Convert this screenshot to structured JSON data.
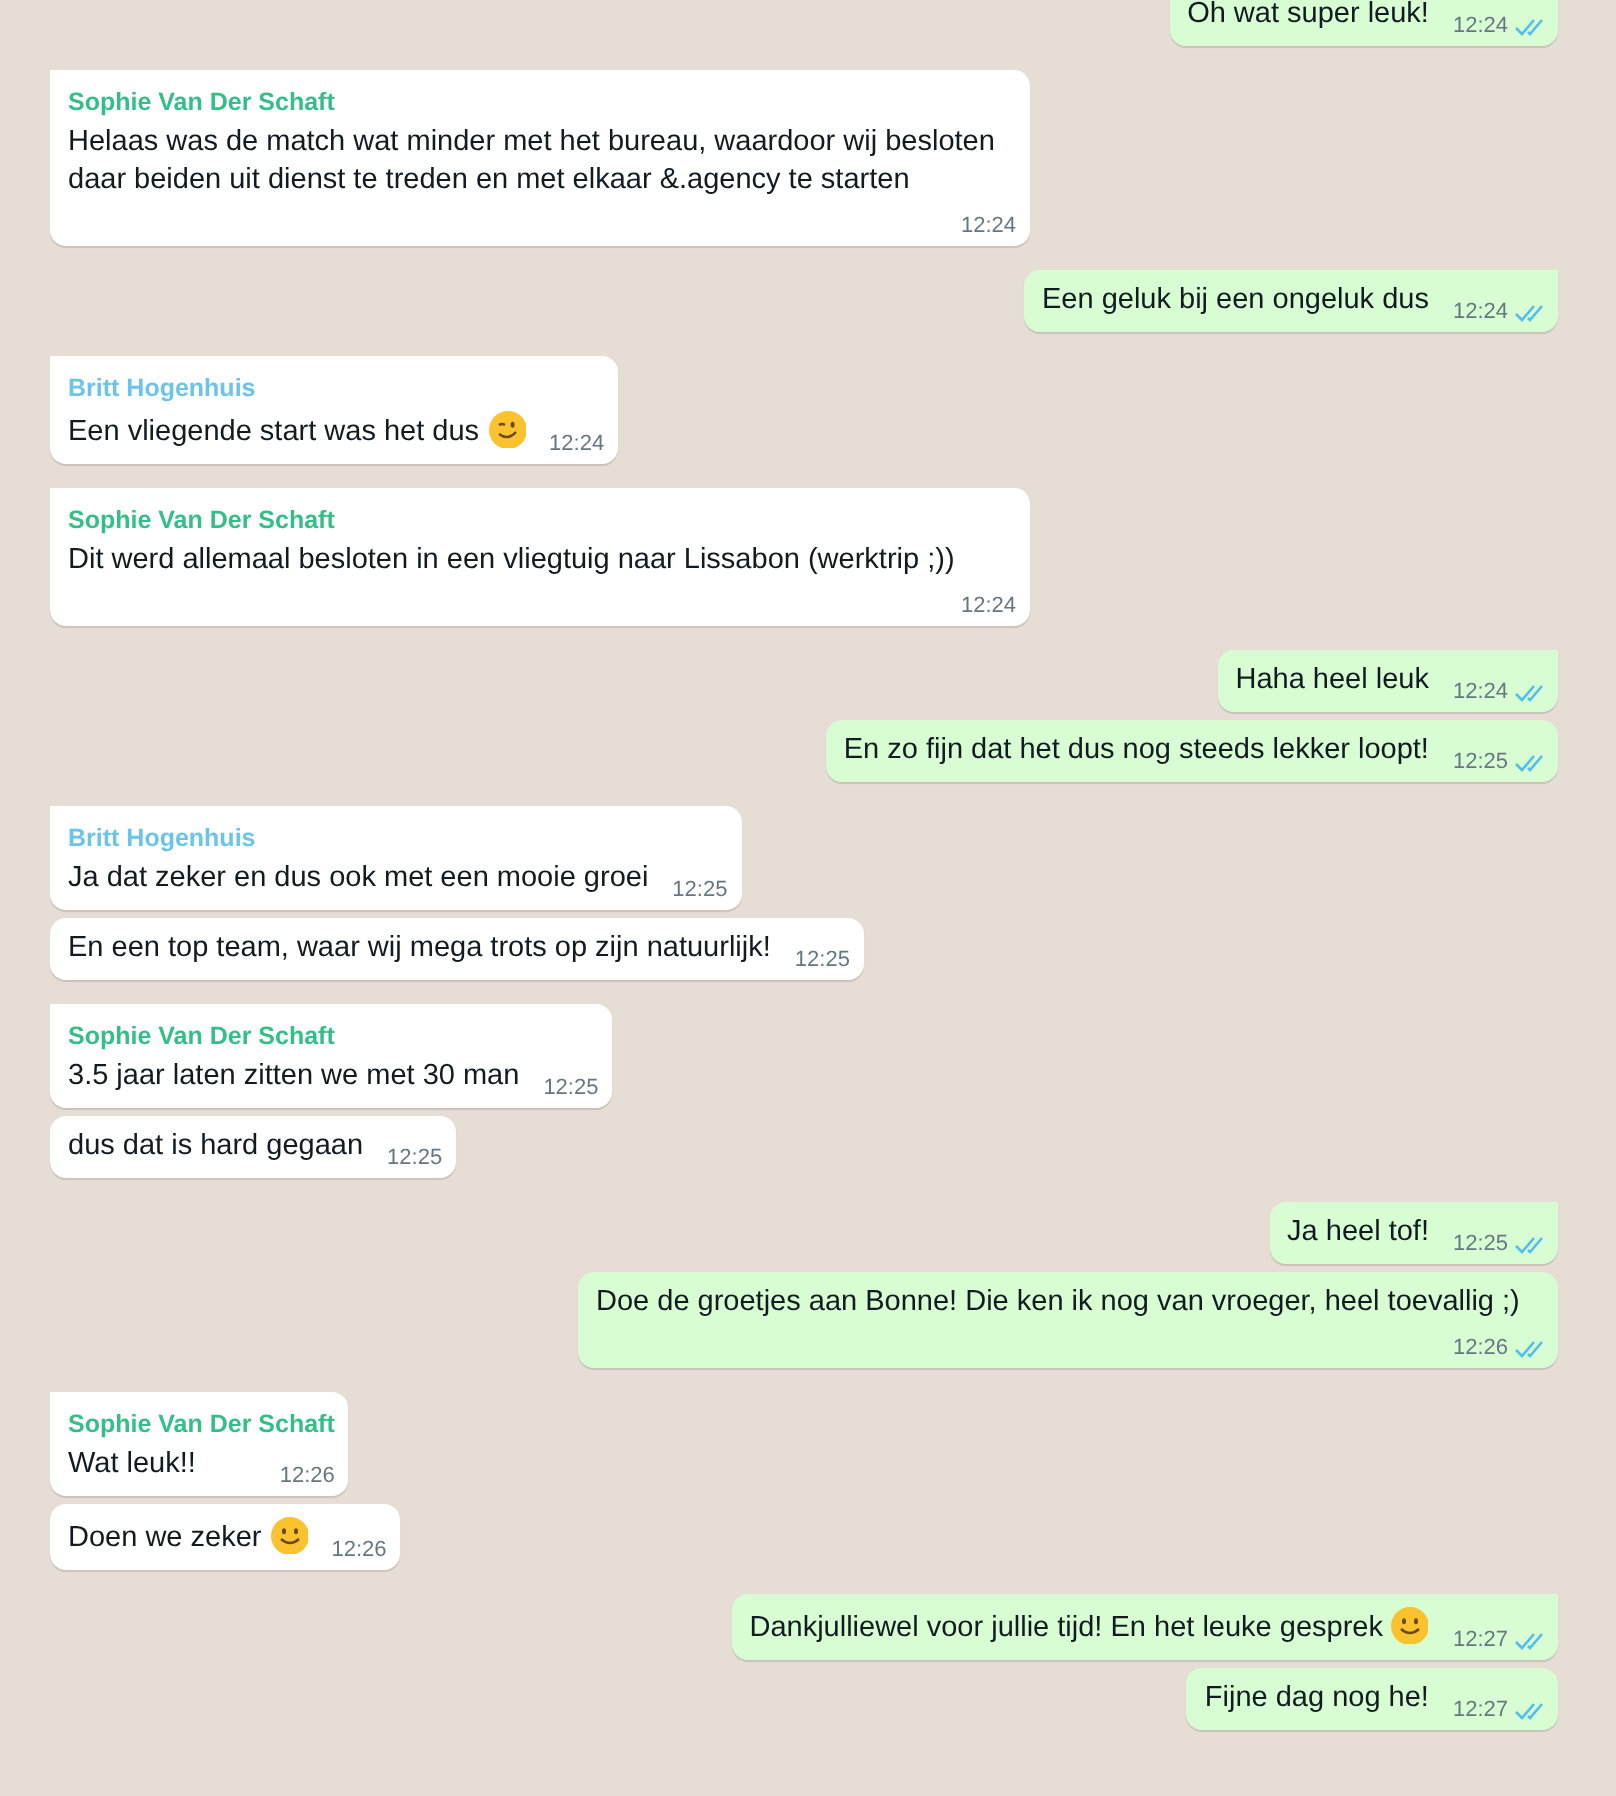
{
  "messages": [
    {
      "kind": "sent",
      "tail": false,
      "text": "Oh wat super leuk!",
      "time": "12:24",
      "read": true
    },
    {
      "kind": "received",
      "tail": true,
      "sender": {
        "name": "Sophie Van Der Schaft",
        "color": "#35bf88"
      },
      "text": "Helaas was de match wat minder met het bureau, waardoor wij besloten daar beiden uit dienst te treden en met elkaar &.agency te starten",
      "time": "12:24"
    },
    {
      "kind": "sent",
      "tail": true,
      "text": "Een geluk bij een ongeluk dus",
      "time": "12:24",
      "read": true
    },
    {
      "kind": "received",
      "tail": true,
      "sender": {
        "name": "Britt Hogenhuis",
        "color": "#6bc4ea"
      },
      "text": "Een vliegende start was het dus",
      "emoji": {
        "kind": "wink"
      },
      "time": "12:24"
    },
    {
      "kind": "received",
      "tail": true,
      "sender": {
        "name": "Sophie Van Der Schaft",
        "color": "#35bf88"
      },
      "text": "Dit werd allemaal besloten in een vliegtuig naar Lissabon (werktrip ;))",
      "time": "12:24"
    },
    {
      "kind": "sent",
      "tail": true,
      "text": "Haha heel leuk",
      "time": "12:24",
      "read": true
    },
    {
      "kind": "sent",
      "tail": false,
      "text": "En zo fijn dat het dus nog steeds lekker loopt!",
      "time": "12:25",
      "read": true
    },
    {
      "kind": "received",
      "tail": true,
      "sender": {
        "name": "Britt Hogenhuis",
        "color": "#6bc4ea"
      },
      "text": "Ja dat zeker en dus ook met een mooie groei",
      "time": "12:25"
    },
    {
      "kind": "received",
      "tail": false,
      "text": "En een top team, waar wij mega trots op zijn natuurlijk!",
      "time": "12:25"
    },
    {
      "kind": "received",
      "tail": true,
      "sender": {
        "name": "Sophie Van Der Schaft",
        "color": "#35bf88"
      },
      "text": "3.5 jaar laten zitten we met 30 man",
      "time": "12:25"
    },
    {
      "kind": "received",
      "tail": false,
      "text": "dus dat is hard gegaan",
      "time": "12:25"
    },
    {
      "kind": "sent",
      "tail": true,
      "text": "Ja heel tof!",
      "time": "12:25",
      "read": true
    },
    {
      "kind": "sent",
      "tail": false,
      "text": "Doe de groetjes aan Bonne! Die ken ik nog van vroeger, heel toevallig ;)",
      "time": "12:26",
      "read": true
    },
    {
      "kind": "received",
      "tail": true,
      "sender": {
        "name": "Sophie Van Der Schaft",
        "color": "#35bf88"
      },
      "text": "Wat leuk!!",
      "time": "12:26"
    },
    {
      "kind": "received",
      "tail": false,
      "text": "Doen we zeker",
      "emoji": {
        "kind": "smile"
      },
      "time": "12:26"
    },
    {
      "kind": "sent",
      "tail": true,
      "text": "Dankjulliewel voor jullie tijd! En het leuke gesprek",
      "emoji": {
        "kind": "smile"
      },
      "time": "12:27",
      "read": true
    },
    {
      "kind": "sent",
      "tail": false,
      "text": "Fijne dag nog he!",
      "time": "12:27",
      "read": true
    }
  ]
}
